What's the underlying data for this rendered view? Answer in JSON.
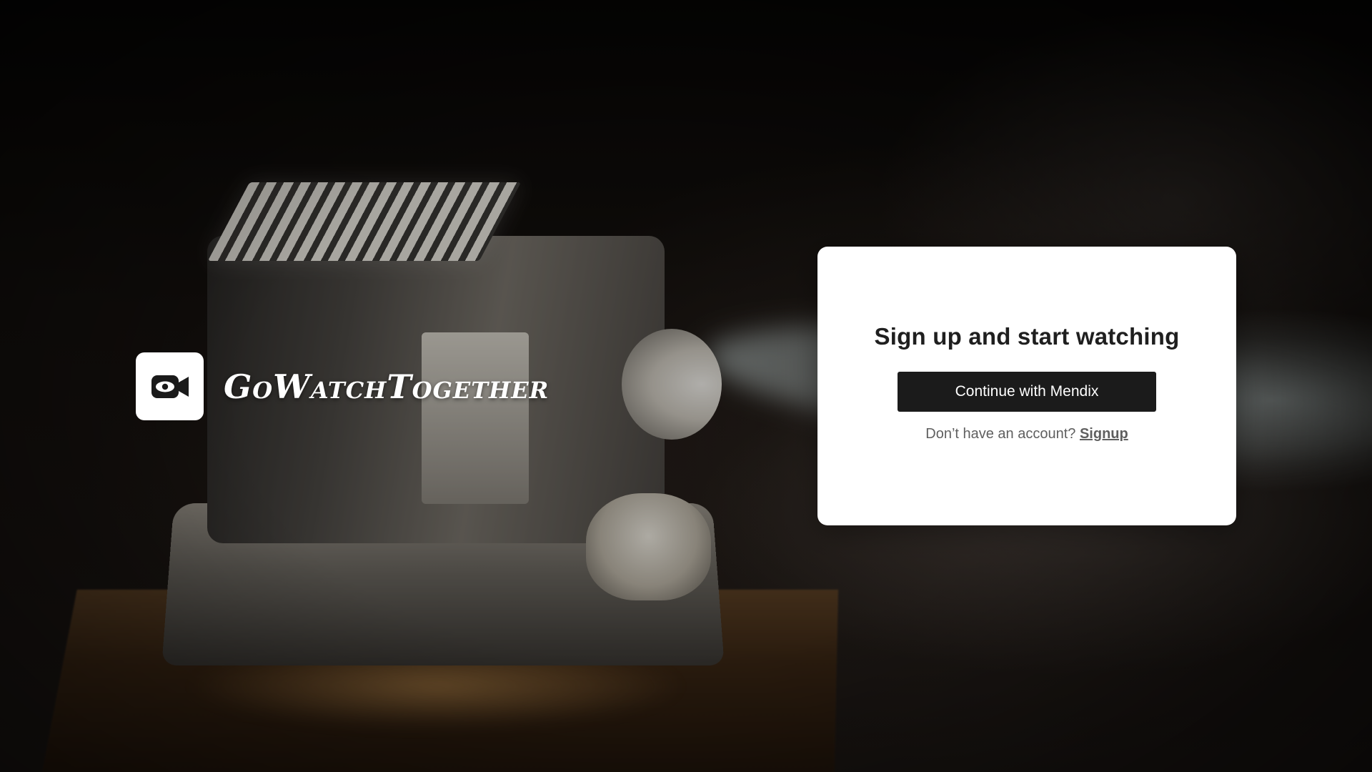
{
  "brand": {
    "name": "GoWatchTogether",
    "logo_icon": "video-camera-eye-icon"
  },
  "signup_card": {
    "title": "Sign up and start watching",
    "primary_button_label": "Continue with Mendix",
    "prompt_text": "Don’t have an account?",
    "signup_link_label": "Signup"
  },
  "colors": {
    "card_background": "#ffffff",
    "button_background": "#1b1b1b",
    "button_text": "#ffffff",
    "title_text": "#1f1f1f",
    "muted_text": "#5f5f5f"
  }
}
